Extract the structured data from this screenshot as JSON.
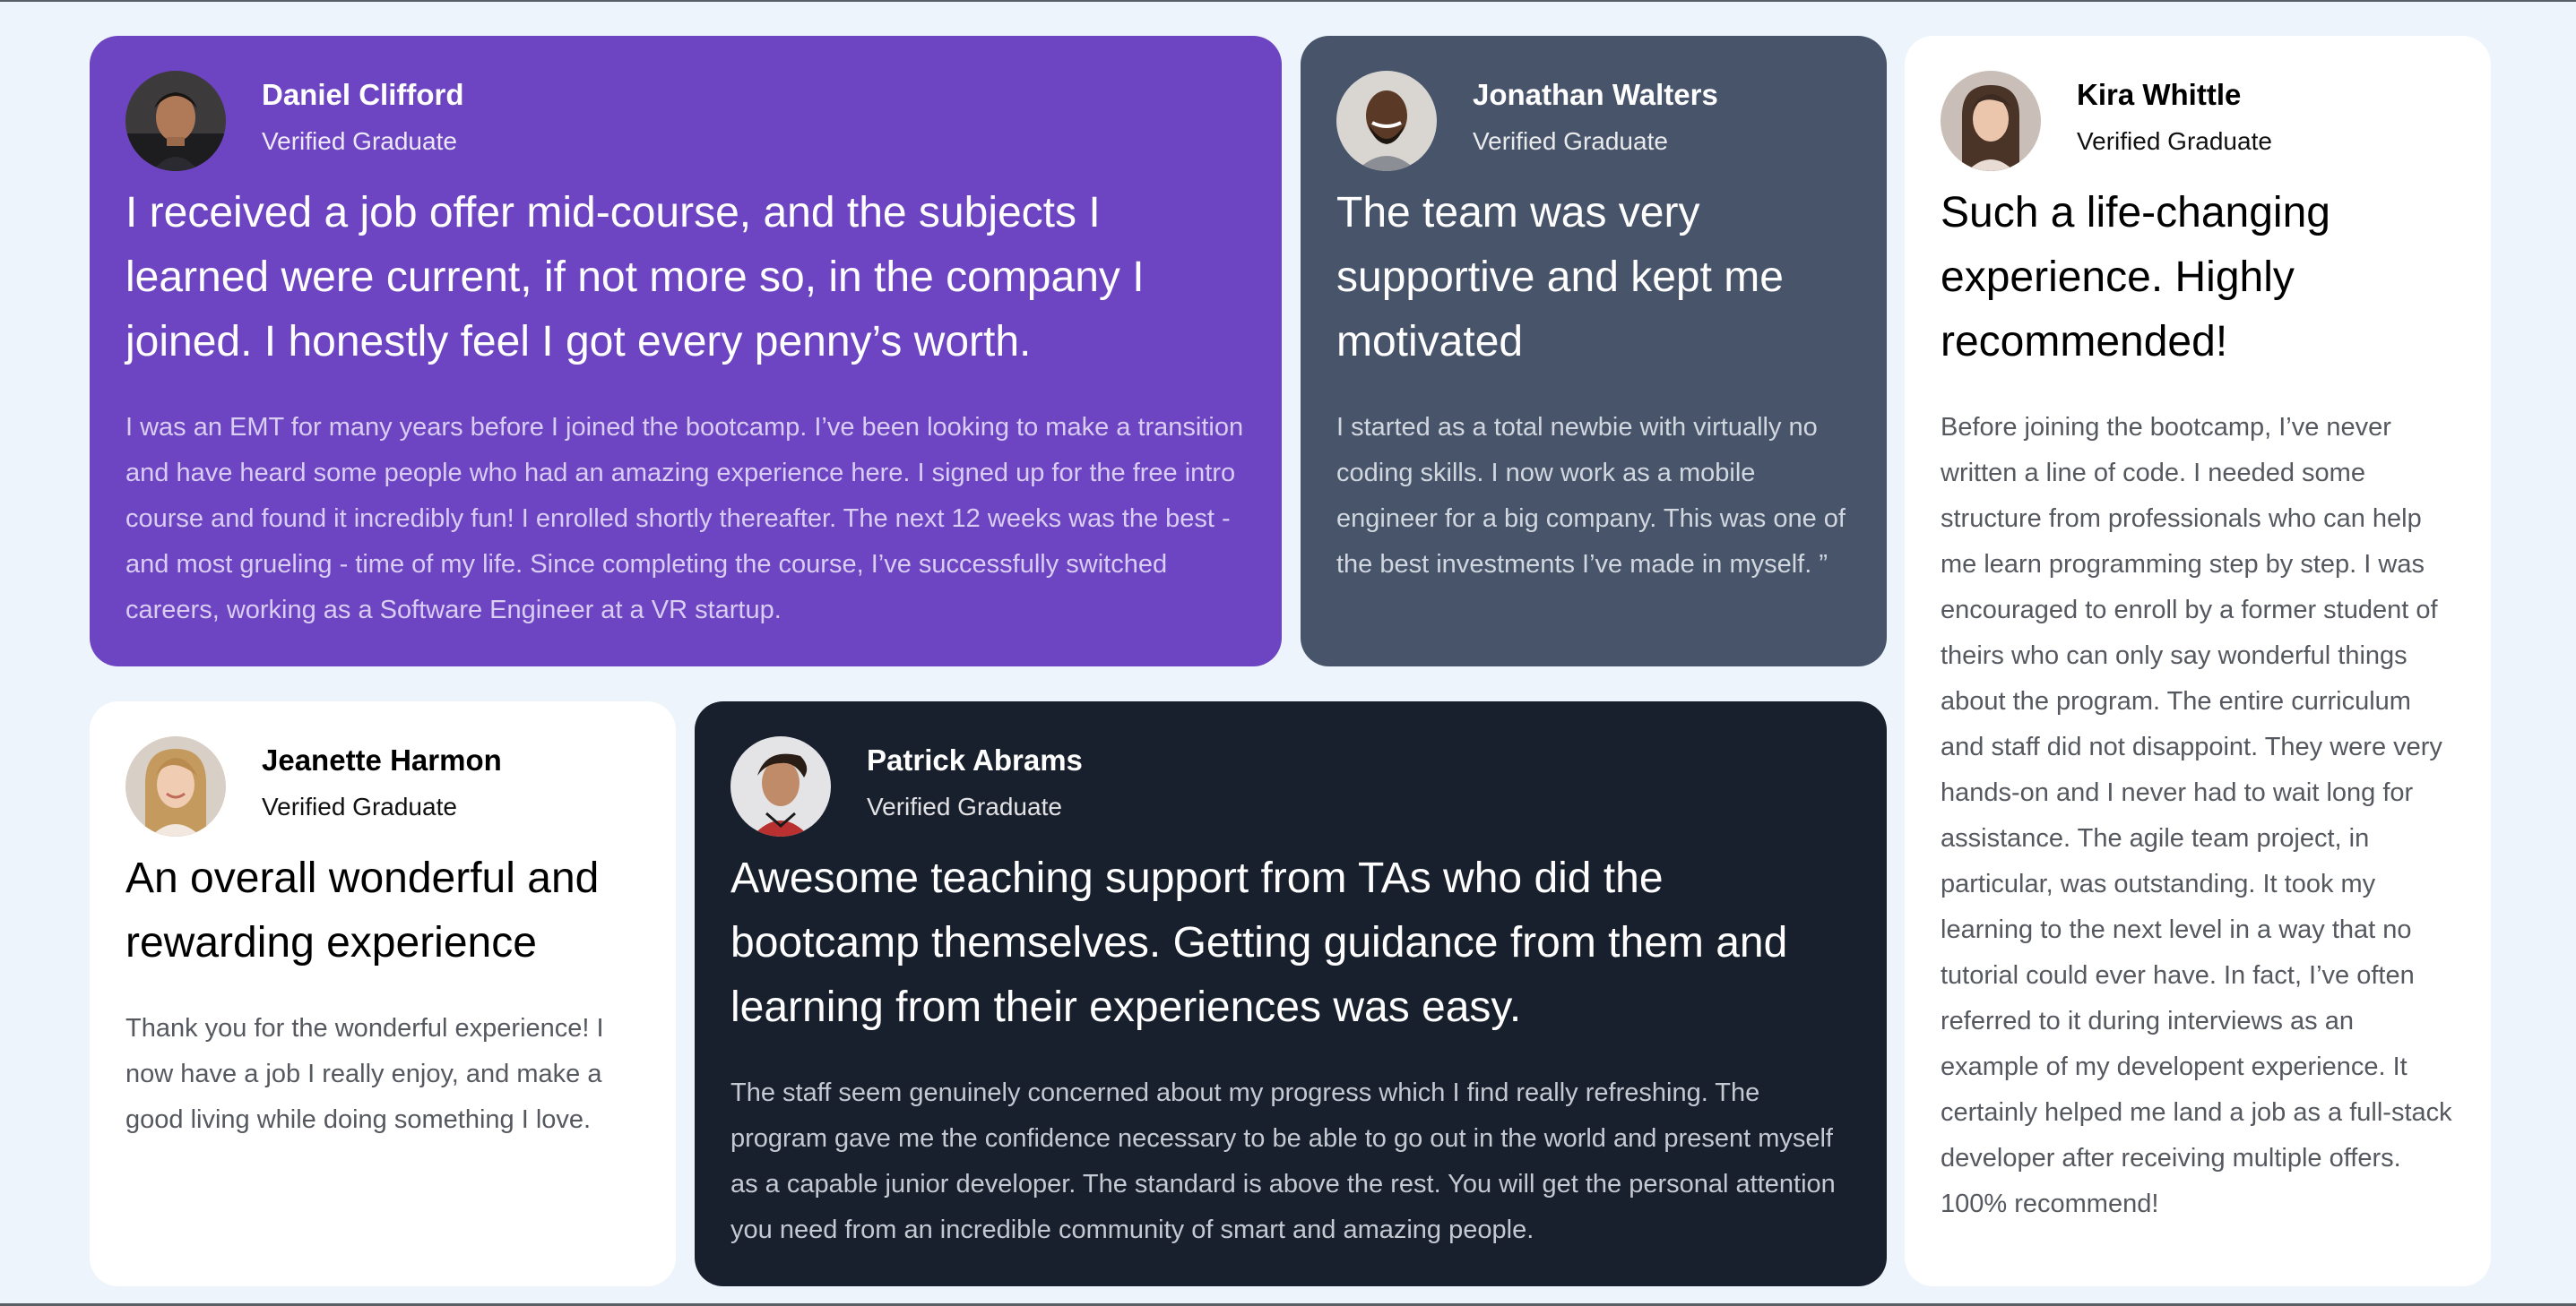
{
  "testimonials": {
    "daniel": {
      "name": "Daniel Clifford",
      "role": "Verified Graduate",
      "headline": "I received a job offer mid-course, and the subjects I learned were current, if not more so, in the company I joined. I honestly feel I got every penny’s worth.",
      "body": "I was an EMT for many years before I joined the bootcamp. I’ve been looking to make a transition and have heard some people who had an amazing experience here. I signed up for the free intro course and found it incredibly fun! I enrolled shortly thereafter. The next 12 weeks was the best - and most grueling - time of my life. Since completing the course, I’ve successfully switched careers, working as a Software Engineer at a VR startup.",
      "color": "#6d44c2"
    },
    "jonathan": {
      "name": "Jonathan Walters",
      "role": "Verified Graduate",
      "headline": "The team was very supportive and kept me motivated",
      "body": "I started as a total newbie with virtually no coding skills. I now work as a mobile engineer for a big company. This was one of the best investments I’ve made in myself. ”",
      "color": "#48546a"
    },
    "kira": {
      "name": "Kira Whittle",
      "role": "Verified Graduate",
      "headline": "Such a life-changing experience. Highly recommended!",
      "body": "Before joining the bootcamp, I’ve never written a line of code. I needed some structure from professionals who can help me learn programming step by step. I was encouraged to enroll by a former student of theirs who can only say wonderful things about the program. The entire curriculum and staff did not disappoint. They were very hands-on and I never had to wait long for assistance. The agile team project, in particular, was outstanding. It took my learning to the next level in a way that no tutorial could ever have. In fact, I’ve often referred to it during interviews as an example of my developent experience. It certainly helped me land a job as a full-stack developer after receiving multiple offers. 100% recommend!",
      "color": "#ffffff"
    },
    "jeanette": {
      "name": "Jeanette Harmon",
      "role": "Verified Graduate",
      "headline": "An overall wonderful and rewarding experience",
      "body": "Thank you for the wonderful experience! I now have a job I really enjoy, and make a good living while doing something I love.",
      "color": "#ffffff"
    },
    "patrick": {
      "name": "Patrick Abrams",
      "role": "Verified Graduate",
      "headline": "Awesome teaching support from TAs who did the bootcamp themselves. Getting guidance from them and learning from their experiences was easy.",
      "body": "The staff seem genuinely concerned about my progress which I find really refreshing. The program gave me the confidence necessary to be able to go out in the world and present myself as a capable junior developer. The standard is above the rest. You will get the personal attention you need from an incredible community of smart and amazing people.",
      "color": "#19202d"
    }
  }
}
